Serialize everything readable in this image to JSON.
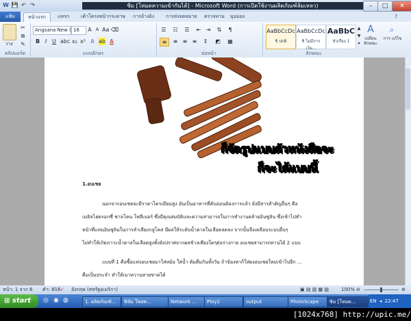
{
  "window": {
    "title": "ซิม [โหมดความเข้ากันได้] - Microsoft Word (การเปิดใช้งานผลิตภัณฑ์ล้มเหลว)",
    "minimize": "–",
    "maximize": "□",
    "close": "✕"
  },
  "quick_access": {
    "save": "💾",
    "undo": "↶",
    "redo": "↷"
  },
  "tabs": {
    "file": "แฟ้ม",
    "items": [
      "หน้าแรก",
      "แทรก",
      "เค้าโครงหน้ากระดาษ",
      "การอ้างอิง",
      "การส่งจดหมาย",
      "ตรวจทาน",
      "มุมมอง"
    ]
  },
  "ribbon": {
    "clipboard": {
      "label": "คลิปบอร์ด",
      "paste": "วาง"
    },
    "font": {
      "label": "แบบอักษร",
      "name": "Angsana New (ข้อ",
      "size": "16",
      "bold": "B",
      "italic": "I",
      "underline": "U",
      "font_color": "A"
    },
    "paragraph": {
      "label": "ย่อหน้า"
    },
    "styles": {
      "label": "ลักษณะ",
      "items": [
        {
          "preview": "AaBbCcDc",
          "name": "¶ ปกติ"
        },
        {
          "preview": "AaBbCcDc",
          "name": "¶ ไม่มีการเว้น..."
        },
        {
          "preview": "AaBbC",
          "name": "หัวเรื่อง 1"
        }
      ],
      "change_styles": "เปลี่ยน ลักษณะ",
      "editing": "การ แก้ไข"
    }
  },
  "document": {
    "overlay_line1": "ก็จัดรูปแบบตัวหนังสือจะ",
    "overlay_line2": "ก็จะได้แบบนี้",
    "heading": "1.อบเชย",
    "paragraph_lines": [
      "นอกจากอบเชยจะมีราคาโครเมียมสูง อันเป็นอาหารที่ดับอ่อนต้องการแล้ว ยังมีสารสำคัญอื่นๆ คือ",
      "เมธิลไฮดรอกซี่ ชาลโคน โพลีเมอร์ ซึ่งมีคุณสมบัติและความสามารถในการทำงานคล้ายอินซูลิน ซึ่งเข้าไปทำ",
      "หน้าที่แทนอินซูลินในการลำเลียงกลูโคส มีผลให้ระดับน้ำตาลในเลือดลดลง จากนั้นจึงเคลือบระบบอื่นๆ",
      "ไม่ทำให้เกิดภาวะน้ำตาลในเลือดสูงทั้งยังปราศจากผลข้างเคียงใดๆต่อร่างกาย อบเชยสามารถทานได้ 2 แบบ"
    ],
    "method_line1": "แบบที่ 1 คือซื้อแท่งอบเชยมาใส่หม้อ ใส่น้ำ ต้มดื่มกินทั้งวัน ถ้าข้องหาก็ใส่ผงอบเชยใหม่เข้าไปอีก ...",
    "method_line2": "ดื่มเป็นประจำ ทำให้เบาหวานหายขาดได้"
  },
  "status": {
    "page": "หน้า: 1 จาก 6",
    "words": "คำ: 816",
    "language": "อังกฤษ (สหรัฐอเมริกา)",
    "zoom": "100%"
  },
  "taskbar": {
    "start": "start",
    "tasks": [
      "1. ผลิตภัณฑ์...",
      "ฟิล์ม โพสต...",
      "Network ...",
      "Ploy2",
      "output",
      "PhotoScape",
      "ซิม [โหมด..."
    ],
    "lang": "EN",
    "clock": "22:47"
  },
  "caption": "[1024x768] http://upic.me/"
}
